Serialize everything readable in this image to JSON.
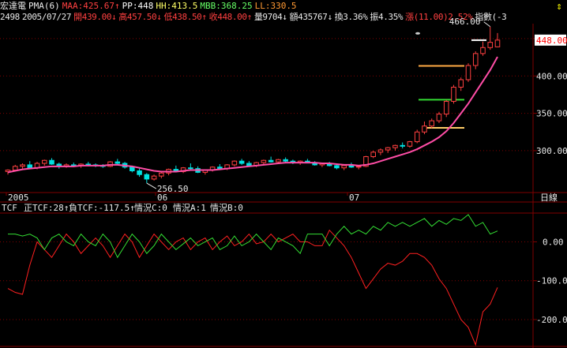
{
  "header": {
    "stock_name": "宏達電",
    "pma": "PMA(6)",
    "maa": "MAA:425.67↑",
    "pp": "PP:448",
    "hh": "HH:413.5",
    "mbb": "MBB:368.25",
    "ll": "LL:330.5",
    "code": "2498",
    "date": "2005/07/27",
    "open": "開439.00↓",
    "high": "高457.50↓",
    "low": "低438.50↑",
    "close": "收448.00↑",
    "volume": "量9704↓",
    "amount": "額435767↓",
    "turnover": "換3.36%",
    "amplitude": "振4.35%",
    "change": "漲(11.00)2.52%",
    "index": "指數(-3"
  },
  "colors": {
    "up": "#ff4040",
    "down": "#00e0e0",
    "ma": "#ff4da6",
    "tcf_pos": "#ff2020",
    "tcf_neg": "#33dd33",
    "grid": "#800000"
  },
  "chart_data": [
    {
      "type": "candlestick",
      "price_axis": {
        "ticks": [
          "450.00",
          "400.00",
          "350.00",
          "300.00"
        ],
        "current": "448.00",
        "range": [
          245,
          470
        ]
      },
      "x_tick_labels": [
        "2005",
        "06",
        "07"
      ],
      "period_button": "日線",
      "annotations": {
        "high_label": "466.00",
        "low_label": "256.50",
        "high_value": 466,
        "low_value": 256.5
      },
      "levels": [
        {
          "name": "HH",
          "value": 413.5,
          "color": "#ffaa44"
        },
        {
          "name": "MBB",
          "value": 368.25,
          "color": "#33dd33"
        },
        {
          "name": "LL",
          "value": 330.5,
          "color": "#ffcc66"
        },
        {
          "name": "PP",
          "value": 448,
          "color": "#ffffff"
        }
      ],
      "candles": [
        [
          272,
          275,
          268,
          274
        ],
        [
          274,
          281,
          272,
          279
        ],
        [
          279,
          283,
          276,
          281
        ],
        [
          281,
          286,
          277,
          277
        ],
        [
          277,
          285,
          275,
          283
        ],
        [
          283,
          288,
          280,
          287
        ],
        [
          287,
          290,
          281,
          282
        ],
        [
          282,
          284,
          276,
          279
        ],
        [
          279,
          283,
          277,
          281
        ],
        [
          281,
          284,
          278,
          280
        ],
        [
          280,
          283,
          277,
          282
        ],
        [
          282,
          285,
          279,
          281
        ],
        [
          281,
          283,
          278,
          280
        ],
        [
          280,
          282,
          277,
          279
        ],
        [
          279,
          286,
          278,
          285
        ],
        [
          285,
          289,
          281,
          283
        ],
        [
          283,
          285,
          276,
          278
        ],
        [
          278,
          280,
          271,
          273
        ],
        [
          273,
          276,
          265,
          268
        ],
        [
          268,
          270,
          256.5,
          262
        ],
        [
          262,
          268,
          260,
          266
        ],
        [
          266,
          271,
          263,
          270
        ],
        [
          270,
          276,
          267,
          275
        ],
        [
          275,
          280,
          271,
          272
        ],
        [
          272,
          278,
          270,
          277
        ],
        [
          277,
          283,
          274,
          276
        ],
        [
          276,
          279,
          270,
          271
        ],
        [
          271,
          275,
          268,
          274
        ],
        [
          274,
          279,
          272,
          278
        ],
        [
          278,
          282,
          275,
          276
        ],
        [
          276,
          282,
          274,
          281
        ],
        [
          281,
          287,
          279,
          286
        ],
        [
          286,
          289,
          281,
          283
        ],
        [
          283,
          286,
          279,
          280
        ],
        [
          280,
          285,
          278,
          284
        ],
        [
          284,
          288,
          281,
          287
        ],
        [
          287,
          292,
          284,
          285
        ],
        [
          285,
          289,
          282,
          288
        ],
        [
          288,
          291,
          284,
          286
        ],
        [
          286,
          288,
          282,
          284
        ],
        [
          284,
          287,
          281,
          286
        ],
        [
          286,
          289,
          283,
          284
        ],
        [
          284,
          286,
          280,
          281
        ],
        [
          281,
          284,
          278,
          283
        ],
        [
          283,
          285,
          279,
          280
        ],
        [
          280,
          282,
          275,
          277
        ],
        [
          277,
          281,
          274,
          280
        ],
        [
          280,
          284,
          277,
          278
        ],
        [
          278,
          281,
          275,
          279
        ],
        [
          279,
          293,
          278,
          292
        ],
        [
          292,
          300,
          290,
          298
        ],
        [
          298,
          303,
          294,
          301
        ],
        [
          301,
          305,
          297,
          304
        ],
        [
          304,
          308,
          300,
          307
        ],
        [
          307,
          311,
          303,
          306
        ],
        [
          306,
          313,
          304,
          312
        ],
        [
          312,
          328,
          310,
          325
        ],
        [
          325,
          339,
          322,
          333
        ],
        [
          333,
          343,
          330,
          340
        ],
        [
          340,
          352,
          337,
          349
        ],
        [
          349,
          368,
          345,
          366
        ],
        [
          366,
          388,
          363,
          385
        ],
        [
          385,
          398,
          380,
          395
        ],
        [
          395,
          417,
          392,
          414
        ],
        [
          414,
          433,
          409,
          430
        ],
        [
          430,
          446,
          427,
          438
        ],
        [
          438,
          466,
          435,
          445
        ],
        [
          439,
          457.5,
          438.5,
          448
        ]
      ],
      "ma": [
        271,
        273,
        275,
        276,
        277,
        278,
        279,
        279,
        279,
        279,
        280,
        280,
        280,
        280,
        281,
        281,
        280,
        279,
        277,
        275,
        273,
        272,
        272,
        272,
        273,
        274,
        274,
        274,
        274,
        275,
        276,
        277,
        278,
        279,
        280,
        281,
        282,
        283,
        284,
        284,
        284,
        284,
        284,
        283,
        283,
        282,
        281,
        281,
        280,
        281,
        283,
        286,
        289,
        292,
        295,
        298,
        302,
        307,
        312,
        318,
        326,
        337,
        350,
        363,
        378,
        393,
        408,
        425.67
      ]
    },
    {
      "type": "line",
      "title": "TCF",
      "indicator_labels": [
        "正TCF:28↑",
        "負TCF:-117.5↑",
        "情況C:0",
        "情況A:1",
        "情況B:0"
      ],
      "y_ticks": [
        "0.00",
        "-100.0",
        "-200.0"
      ],
      "range": [
        -265,
        70
      ],
      "series": [
        {
          "name": "正TCF",
          "values": [
            -120,
            -130,
            -135,
            -60,
            0,
            -20,
            -40,
            -10,
            20,
            0,
            -30,
            -10,
            10,
            -10,
            -40,
            -10,
            20,
            0,
            -40,
            -10,
            20,
            0,
            -20,
            0,
            10,
            -20,
            0,
            10,
            -20,
            0,
            15,
            -10,
            0,
            20,
            -5,
            0,
            20,
            0,
            10,
            20,
            0,
            0,
            -10,
            -10,
            30,
            10,
            -10,
            -40,
            -80,
            -120,
            -95,
            -70,
            -55,
            -60,
            -50,
            -30,
            -30,
            -40,
            -60,
            -95,
            -120,
            -160,
            -200,
            -220,
            -265,
            -180,
            -160,
            -117.5
          ]
        },
        {
          "name": "負TCF",
          "values": [
            20,
            20,
            15,
            20,
            10,
            -20,
            10,
            20,
            0,
            -10,
            20,
            0,
            -10,
            20,
            0,
            -40,
            -10,
            20,
            0,
            -30,
            -10,
            20,
            0,
            -20,
            -5,
            10,
            -10,
            0,
            10,
            -20,
            -10,
            15,
            -10,
            0,
            20,
            0,
            -20,
            10,
            0,
            -10,
            -30,
            20,
            20,
            20,
            -10,
            20,
            40,
            20,
            30,
            20,
            40,
            30,
            50,
            40,
            50,
            40,
            50,
            60,
            40,
            55,
            45,
            60,
            55,
            70,
            40,
            50,
            20,
            28
          ]
        }
      ]
    }
  ]
}
